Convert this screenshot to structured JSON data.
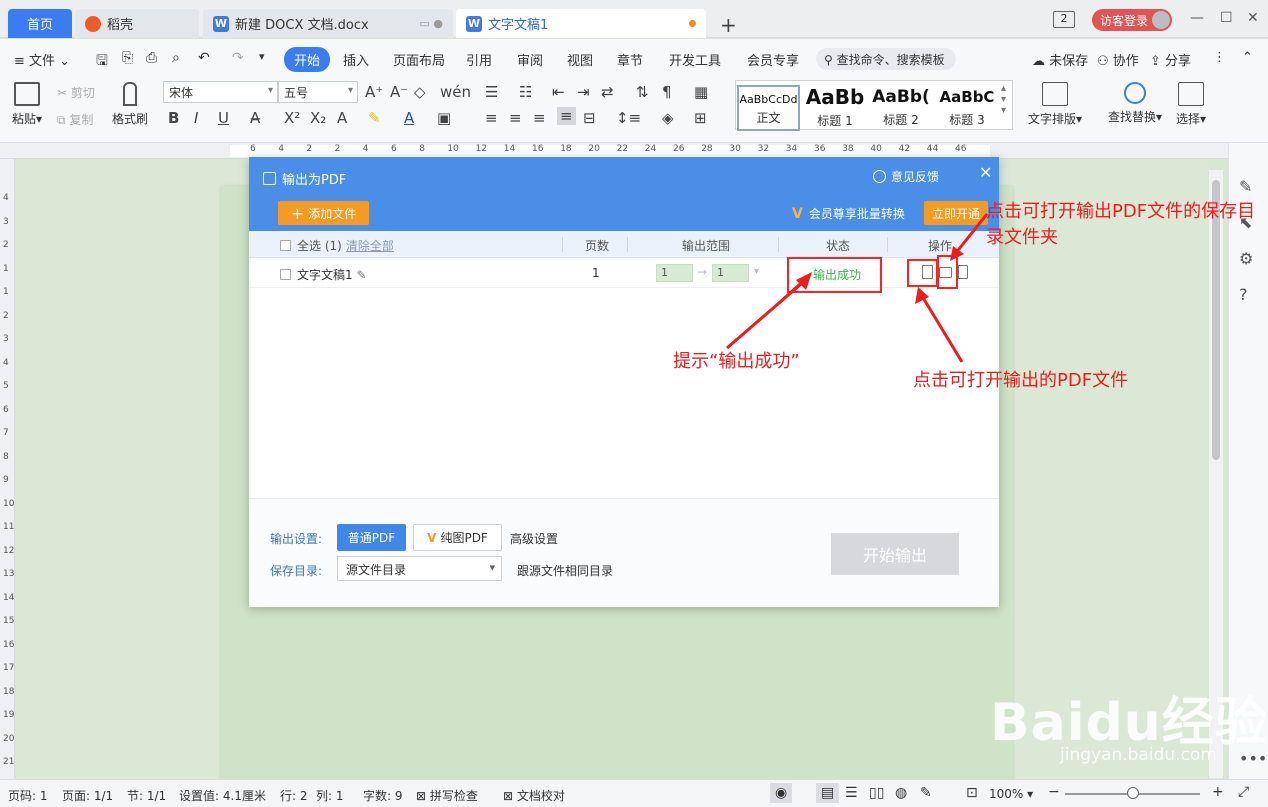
{
  "tabs": [
    {
      "label": "首页"
    },
    {
      "label": "稻壳"
    },
    {
      "label": "新建 DOCX 文档.docx"
    },
    {
      "label": "文字文稿1"
    }
  ],
  "header": {
    "count_badge": "2",
    "login": "访客登录"
  },
  "menu": {
    "file": "文件",
    "items": [
      "开始",
      "插入",
      "页面布局",
      "引用",
      "审阅",
      "视图",
      "章节",
      "开发工具",
      "会员专享"
    ],
    "search_placeholder": "查找命令、搜索模板",
    "unsaved": "未保存",
    "collab": "协作",
    "share": "分享"
  },
  "ribbon": {
    "paste": "粘贴",
    "cut": "剪切",
    "copy": "复制",
    "format_painter": "格式刷",
    "font_name": "宋体",
    "font_size": "五号",
    "styles": [
      {
        "preview": "AaBbCcDd",
        "label": "正文"
      },
      {
        "preview": "AaBb",
        "label": "标题 1"
      },
      {
        "preview": "AaBb(",
        "label": "标题 2"
      },
      {
        "preview": "AaBbC",
        "label": "标题 3"
      }
    ],
    "text_layout": "文字排版",
    "find_replace": "查找替换",
    "select": "选择"
  },
  "ruler_numbers": [
    "6",
    "4",
    "2",
    "2",
    "4",
    "6",
    "8",
    "10",
    "12",
    "14",
    "16",
    "18",
    "20",
    "22",
    "24",
    "26",
    "28",
    "30",
    "32",
    "34",
    "36",
    "38",
    "40",
    "42",
    "44",
    "46"
  ],
  "vruler_numbers": [
    "4",
    "3",
    "2",
    "1",
    "1",
    "2",
    "3",
    "4",
    "5",
    "6",
    "7",
    "8",
    "9",
    "10",
    "11",
    "12",
    "13",
    "14",
    "15",
    "16",
    "17",
    "18",
    "19",
    "20",
    "21",
    "22"
  ],
  "dialog": {
    "title": "输出为PDF",
    "feedback": "意见反馈",
    "add_file": "添加文件",
    "vip_note": "会员尊享批量转换",
    "open_now": "立即开通",
    "columns": {
      "select_all": "全选 (1)",
      "clear_all": "清除全部",
      "pages": "页数",
      "range": "输出范围",
      "status": "状态",
      "actions": "操作"
    },
    "rows": [
      {
        "name": "文字文稿1",
        "pages": "1",
        "from": "1",
        "to": "1",
        "status": "输出成功"
      }
    ],
    "output_settings_label": "输出设置:",
    "normal_pdf": "普通PDF",
    "pure_pdf": "纯图PDF",
    "advanced": "高级设置",
    "save_dir_label": "保存目录:",
    "save_dir": "源文件目录",
    "same_dir": "跟源文件相同目录",
    "start": "开始输出"
  },
  "annotations": {
    "open_folder": "点击可打开输出PDF文件的保存目录文件夹",
    "success_hint": "提示“输出成功”",
    "open_pdf": "点击可打开输出的PDF文件"
  },
  "watermark": {
    "brand": "Baidu经验",
    "url": "jingyan.baidu.com"
  },
  "status": {
    "page_num": "页码: 1",
    "page": "页面: 1/1",
    "section": "节: 1/1",
    "setting": "设置值: 4.1厘米",
    "row": "行: 2",
    "col": "列: 1",
    "words": "字数: 9",
    "spell": "拼写检查",
    "proof": "文档校对",
    "zoom": "100%"
  },
  "colors": {
    "accent": "#3b7cf2",
    "dialog_header": "#4a8ee8",
    "orange": "#f59a23",
    "success": "#3cb34a",
    "annotation": "#ee1c1c"
  }
}
